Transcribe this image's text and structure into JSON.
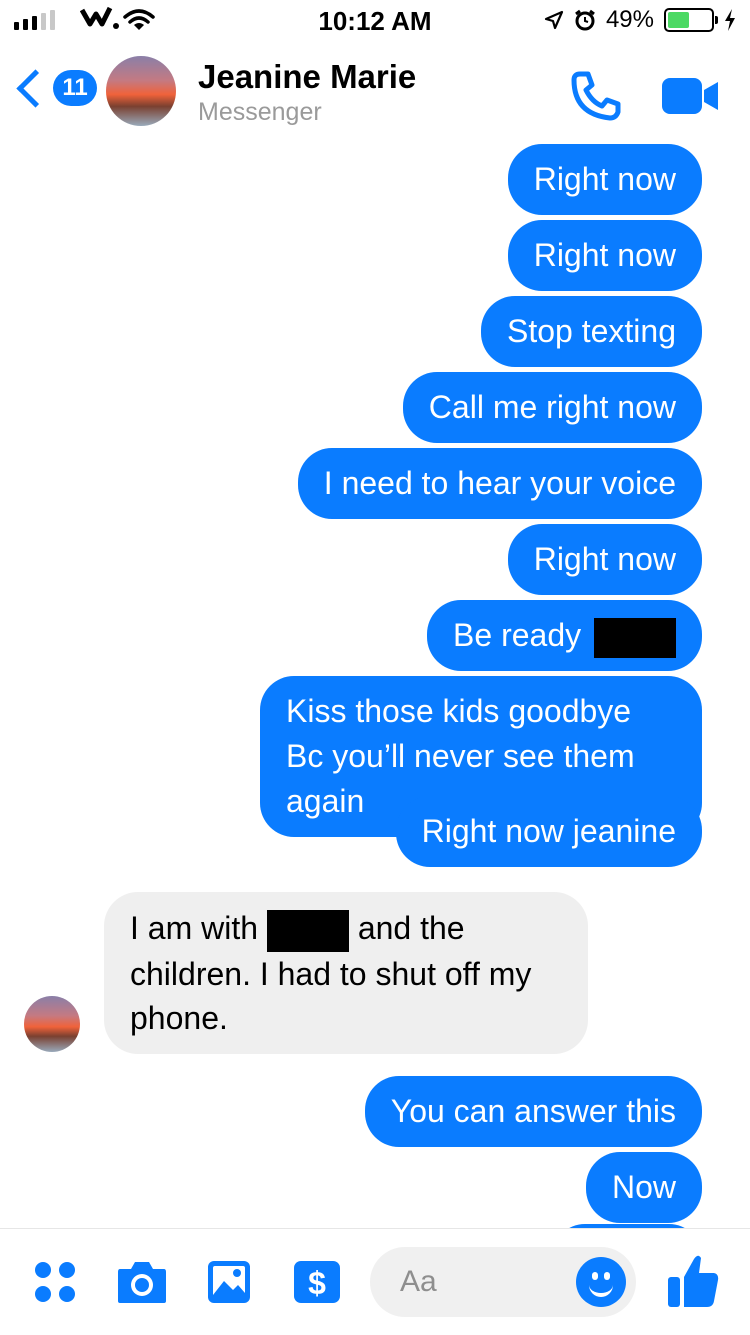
{
  "status_bar": {
    "time": "10:12 AM",
    "battery": "49%",
    "battery_level": 0.49
  },
  "header": {
    "back_count": "11",
    "contact_name": "Jeanine Marie",
    "subtitle": "Messenger",
    "icons": [
      "back-chevron-icon",
      "phone-icon",
      "video-camera-icon"
    ]
  },
  "messages": {
    "out": [
      "Right now",
      "Right now",
      "Stop texting",
      "Call me right now",
      "I need to hear your voice",
      "Right now",
      "Be ready",
      "Kiss those kids goodbye Bc you’ll never see them again",
      "Right now jeanine"
    ],
    "in": {
      "part1": "I am with",
      "part2": "and the children. I had to shut off my phone."
    },
    "out_after": [
      "You can answer this",
      "Now"
    ]
  },
  "composer": {
    "placeholder": "Aa",
    "icons": [
      "menu-dots-icon",
      "camera-icon",
      "image-icon",
      "payment-icon",
      "emoji-icon",
      "thumbs-up-icon"
    ]
  },
  "colors": {
    "accent": "#0a7cff",
    "incoming_bubble": "#efefef",
    "battery_fill": "#4cd964"
  }
}
